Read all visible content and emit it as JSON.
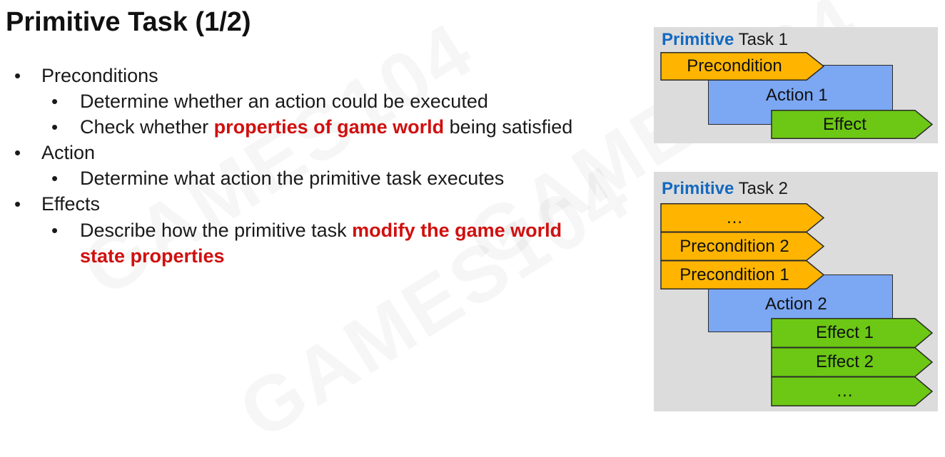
{
  "slide": {
    "title": "Primitive Task (1/2)",
    "watermark": "GAMES104"
  },
  "bullets": {
    "preconditions": "Preconditions",
    "pre_sub1": "Determine whether an action could be executed",
    "pre_sub2_a": "Check whether ",
    "pre_sub2_em": "properties of game world",
    "pre_sub2_b": " being satisfied",
    "action": "Action",
    "action_sub1": "Determine what action the primitive task executes",
    "effects": "Effects",
    "eff_sub1_a": "Describe how the primitive task ",
    "eff_sub1_em": "modify the game world",
    "eff_sub1_em2": "state properties"
  },
  "task1": {
    "title_em": "Primitive",
    "title_rest": " Task 1",
    "precondition": "Precondition",
    "action": "Action 1",
    "effect": "Effect"
  },
  "task2": {
    "title_em": "Primitive",
    "title_rest": " Task 2",
    "pre_more": "…",
    "precondition2": "Precondition 2",
    "precondition1": "Precondition 1",
    "action": "Action 2",
    "effect1": "Effect 1",
    "effect2": "Effect 2",
    "eff_more": "…"
  },
  "colors": {
    "precondition": "#ffb500",
    "action": "#7ba7f3",
    "effect": "#6cc814",
    "primitive_word": "#1469c0",
    "emphasis": "#d0100f",
    "panel": "#dcdcdc"
  }
}
